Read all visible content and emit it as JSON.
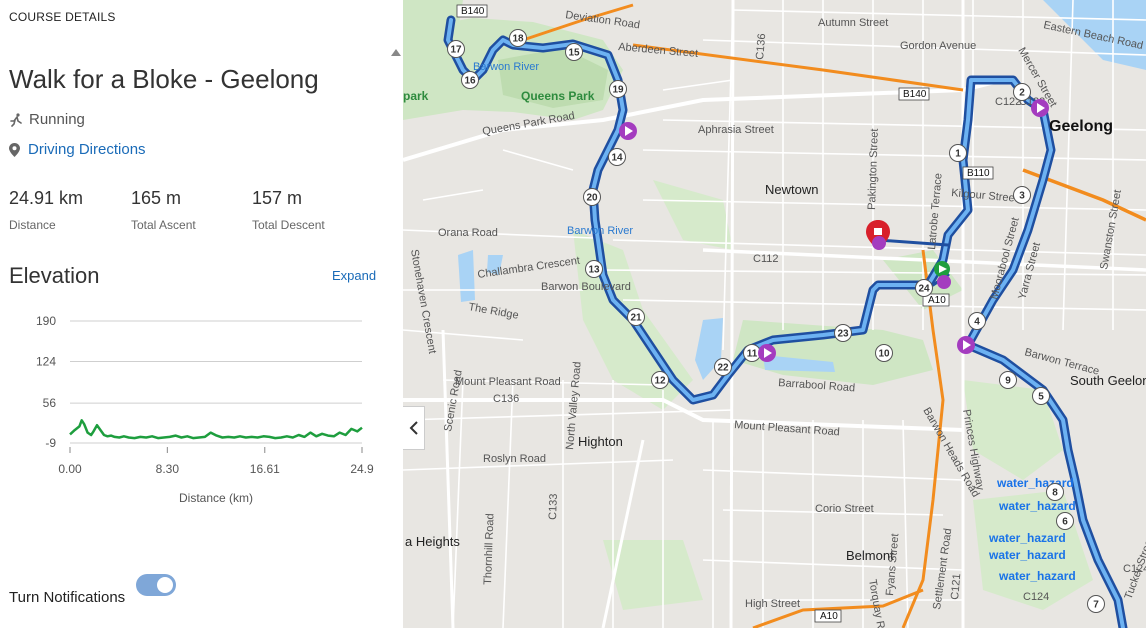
{
  "panel": {
    "section_label": "COURSE DETAILS",
    "title": "Walk for a Bloke - Geelong",
    "activity": "Running",
    "activity_icon": "running-person-icon",
    "directions": "Driving Directions",
    "directions_icon": "location-pin-icon"
  },
  "stats": [
    {
      "value": "24.91 km",
      "label": "Distance"
    },
    {
      "value": "165 m",
      "label": "Total Ascent"
    },
    {
      "value": "157 m",
      "label": "Total Descent"
    }
  ],
  "elevation": {
    "title": "Elevation",
    "expand": "Expand"
  },
  "chart_data": {
    "type": "area",
    "title": "Elevation",
    "xlabel": "Distance (km)",
    "ylabel": "",
    "yticks": [
      "190",
      "124",
      "56",
      "-9"
    ],
    "xticks": [
      "0.00",
      "8.30",
      "16.61",
      "24.9"
    ],
    "ylim": [
      -9,
      190
    ],
    "xlim": [
      0,
      24.9
    ],
    "grid": true,
    "line_color": "#1e9e3e",
    "series": [
      {
        "x": [
          0,
          0.4,
          0.8,
          1.0,
          1.2,
          1.5,
          1.8,
          2.0,
          2.3,
          2.6,
          2.9,
          3.2,
          3.5,
          3.8,
          4.2,
          4.6,
          5.0,
          5.5,
          6.0,
          6.5,
          7.0,
          7.5,
          8.0,
          8.5,
          9.0,
          9.5,
          10.0,
          10.5,
          11.0,
          11.5,
          12.0,
          12.5,
          13.0,
          13.5,
          14.0,
          14.5,
          15.0,
          15.5,
          16.0,
          16.5,
          17.0,
          17.5,
          18.0,
          18.5,
          19.0,
          19.5,
          20.0,
          20.5,
          21.0,
          21.5,
          22.0,
          22.5,
          23.0,
          23.5,
          24.0,
          24.5,
          24.9
        ],
        "y": [
          5,
          12,
          18,
          28,
          22,
          8,
          4,
          10,
          20,
          12,
          4,
          2,
          3,
          1,
          0,
          2,
          0,
          -1,
          1,
          0,
          2,
          -1,
          0,
          1,
          3,
          0,
          2,
          -1,
          0,
          1,
          8,
          3,
          0,
          1,
          0,
          2,
          0,
          1,
          0,
          2,
          1,
          -1,
          0,
          2,
          0,
          4,
          1,
          8,
          2,
          6,
          3,
          2,
          8,
          4,
          14,
          10,
          16
        ]
      }
    ]
  },
  "notifications": {
    "label": "Turn Notifications",
    "enabled": true
  },
  "map": {
    "suburbs": [
      "Newtown",
      "Geelong",
      "Highton",
      "Belmont",
      "South Geelong",
      "a Heights"
    ],
    "parks": [
      "Queens Park",
      "park"
    ],
    "water_labels": [
      "Barwon River",
      "Barwon River"
    ],
    "hazards": [
      "water_hazard",
      "water_hazard",
      "water_hazard",
      "water_hazard",
      "water_hazard"
    ],
    "shields": [
      "B140",
      "B140",
      "B110",
      "A10",
      "A10",
      "C112",
      "C136",
      "C136",
      "C121",
      "C122",
      "C123",
      "C124",
      "C124",
      "C133"
    ],
    "streets": [
      "Autumn Street",
      "Deviation Road",
      "Aberdeen Street",
      "Gordon Avenue",
      "Aphrasia Street",
      "Queens Park Road",
      "Orana Road",
      "Challambra Crescent",
      "Barwon Boulevard",
      "The Ridge",
      "Stonehaven Crescent",
      "Mount Pleasant Road",
      "Mount Pleasant Road",
      "Barrabool Road",
      "Barwon Terrace",
      "Scenic Road",
      "Roslyn Road",
      "North Valley Road",
      "Thornhill Road",
      "Corio Street",
      "High Street",
      "Princes Highway",
      "Barwon Heads Road",
      "Pakington Street",
      "Latrobe Terrace",
      "Moorabool Street",
      "Yarra Street",
      "Swanston Street",
      "Fyans Street",
      "Kilgour Street",
      "Eastern Beach Road",
      "Mercer Street",
      "Tucker Street",
      "Settlement Road",
      "Torquay Road"
    ],
    "waypoints": [
      "1",
      "2",
      "3",
      "4",
      "5",
      "6",
      "7",
      "8",
      "9",
      "10",
      "11",
      "12",
      "13",
      "14",
      "15",
      "16",
      "17",
      "18",
      "19",
      "20",
      "21",
      "22",
      "23",
      "24"
    ],
    "route_color": "#1f6fd1",
    "collapse_icon": "chevron-left-icon"
  }
}
